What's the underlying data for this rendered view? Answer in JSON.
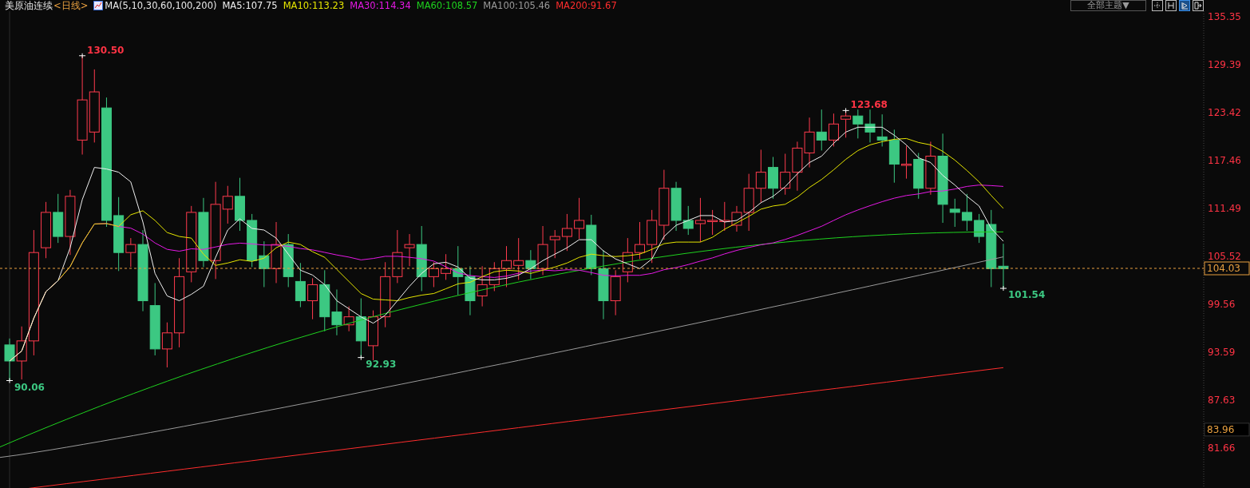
{
  "header": {
    "symbol": "美原油连续",
    "period": "<日线>",
    "indicator": "MA(5,10,30,60,100,200)",
    "ma_values": [
      {
        "label": "MA5:107.75",
        "color": "#f0f0f0"
      },
      {
        "label": "MA10:113.23",
        "color": "#e6e600"
      },
      {
        "label": "MA30:114.34",
        "color": "#e619e6"
      },
      {
        "label": "MA60:108.57",
        "color": "#1ed21e"
      },
      {
        "label": "MA100:105.46",
        "color": "#9a9a9a"
      },
      {
        "label": "MA200:91.67",
        "color": "#ff2d2d"
      }
    ]
  },
  "toolbar": {
    "theme_dropdown": "全部主题▼",
    "buttons": [
      {
        "kind": "crosshair",
        "selected": false
      },
      {
        "kind": "range",
        "selected": false
      },
      {
        "kind": "play",
        "selected": true
      },
      {
        "kind": "exit",
        "selected": false
      }
    ]
  },
  "price_axis": {
    "ticks": [
      "135.35",
      "129.39",
      "123.42",
      "117.46",
      "111.49",
      "105.52",
      "99.56",
      "93.59",
      "87.63",
      "81.66"
    ]
  },
  "price_markers": [
    {
      "kind": "high",
      "label": "130.50"
    },
    {
      "kind": "high",
      "label": "123.68"
    },
    {
      "kind": "low",
      "label": "101.54"
    },
    {
      "kind": "low",
      "label": "92.93"
    },
    {
      "kind": "low",
      "label": "90.06"
    }
  ],
  "price_tags": [
    {
      "kind": "last",
      "label": "104.03"
    },
    {
      "kind": "reference",
      "label": "83.96"
    }
  ]
}
